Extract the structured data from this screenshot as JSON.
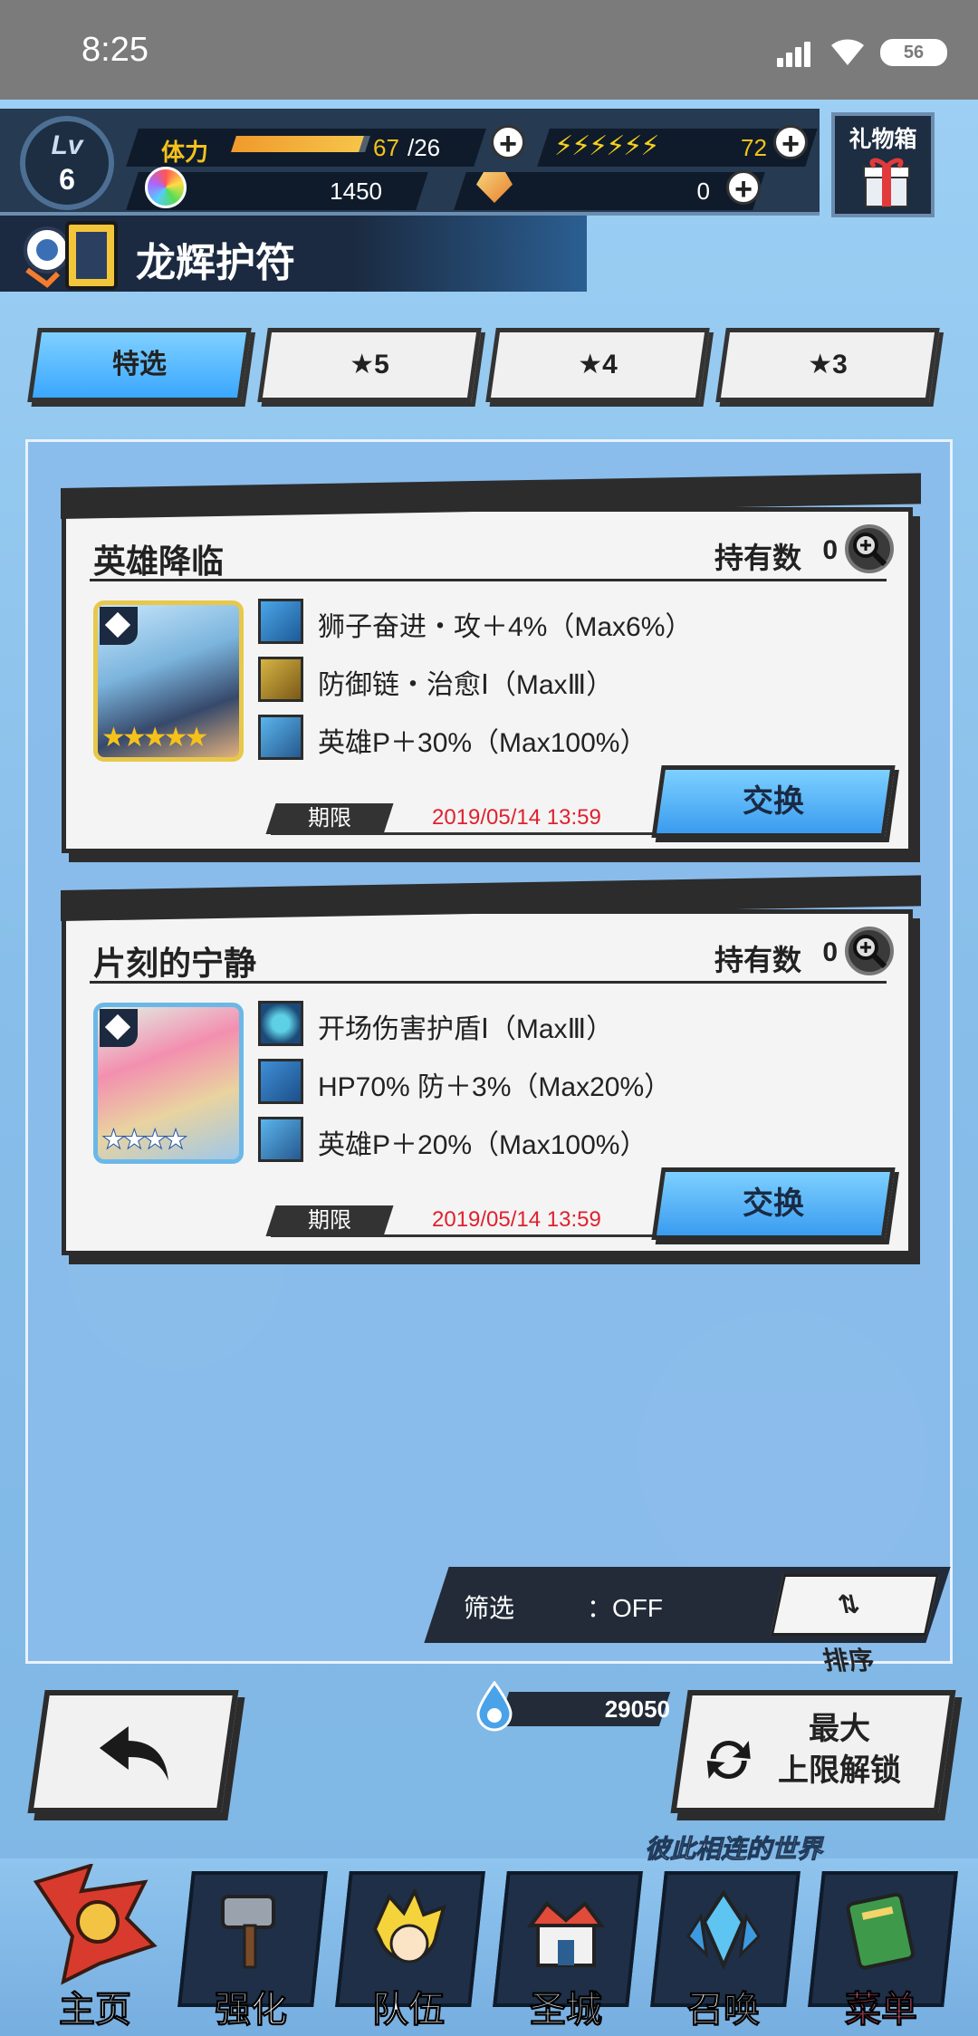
{
  "status_bar": {
    "time": "8:25",
    "battery": "56"
  },
  "hud": {
    "level_label": "Lv",
    "level": "6",
    "stamina_label": "体力",
    "stamina_value": "67",
    "stamina_max": "/26",
    "stamina_fill_fraction": 0.95,
    "energy_value": "72",
    "gems": "1450",
    "crystals": "0",
    "gift_label": "礼物箱"
  },
  "page_title": "龙辉护符",
  "tabs": [
    {
      "label": "特选",
      "active": true
    },
    {
      "label": "★5",
      "active": false
    },
    {
      "label": "★4",
      "active": false
    },
    {
      "label": "★3",
      "active": false
    }
  ],
  "cards": [
    {
      "name": "英雄降临",
      "own_label": "持有数",
      "own_value": "0",
      "stars": "★★★★★",
      "star_color": "#f5c21b",
      "skills": [
        {
          "text": "狮子奋进・攻＋4%（Max6%）",
          "icon": "sword-skill-icon"
        },
        {
          "text": "防御链・治愈Ⅰ（MaxⅢ）",
          "icon": "chain-skill-icon"
        },
        {
          "text": "英雄P＋30%（Max100%）",
          "icon": "hero-point-icon"
        }
      ],
      "limit_label": "期限",
      "limit_date": "2019/05/14  13:59",
      "button": "交换"
    },
    {
      "name": "片刻的宁静",
      "own_label": "持有数",
      "own_value": "0",
      "stars": "★★★★",
      "star_color": "#ffffff",
      "skills": [
        {
          "text": "开场伤害护盾Ⅰ（MaxⅢ）",
          "icon": "shield-orb-icon"
        },
        {
          "text": "HP70%  防＋3%（Max20%）",
          "icon": "defense-shield-icon"
        },
        {
          "text": "英雄P＋20%（Max100%）",
          "icon": "hero-point-icon"
        }
      ],
      "limit_label": "期限",
      "limit_date": "2019/05/14  13:59",
      "button": "交换"
    }
  ],
  "filter": {
    "label": "筛选",
    "value": "：OFF",
    "sort_label": "排序"
  },
  "currency": "29050",
  "unlock_button": {
    "line1": "最大",
    "line2": "上限解锁"
  },
  "nav": {
    "world_label": "彼此相连的世界",
    "items": [
      {
        "label": "主页",
        "icon": "home-banner-icon"
      },
      {
        "label": "强化",
        "icon": "hammer-icon"
      },
      {
        "label": "队伍",
        "icon": "party-icon"
      },
      {
        "label": "圣城",
        "icon": "castle-icon"
      },
      {
        "label": "召唤",
        "icon": "crystal-icon"
      },
      {
        "label": "菜单",
        "icon": "book-icon"
      }
    ]
  }
}
